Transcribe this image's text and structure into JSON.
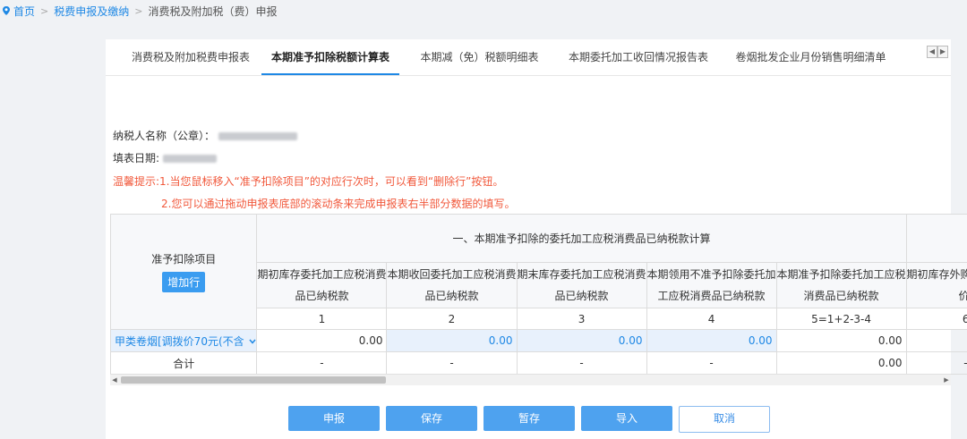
{
  "breadcrumb": {
    "home": "首页",
    "level2": "税费申报及缴纳",
    "current": "消费税及附加税（费）申报",
    "separator": ">"
  },
  "tabs": [
    {
      "label": "消费税及附加税费申报表",
      "active": false
    },
    {
      "label": "本期准予扣除税额计算表",
      "active": true
    },
    {
      "label": "本期减（免）税额明细表",
      "active": false
    },
    {
      "label": "本期委托加工收回情况报告表",
      "active": false
    },
    {
      "label": "卷烟批发企业月份销售明细清单",
      "active": false
    }
  ],
  "info": {
    "taxpayer_label": "纳税人名称（公章）：",
    "date_label": "填表日期:",
    "tip_label": "温馨提示:",
    "tip1": "1.当您鼠标移入“准予扣除项目”的对应行次时，可以看到“删除行”按钮。",
    "tip2": "2.您可以通过拖动申报表底部的滚动条来完成申报表右半部分数据的填写。"
  },
  "table": {
    "item_header": "准予扣除项目",
    "add_row": "增加行",
    "group_header": "一、本期准予扣除的委托加工应税消费品已纳税款计算",
    "columns": [
      {
        "line1": "期初库存委托加工应税消费",
        "line2": "品已纳税款",
        "no": "1"
      },
      {
        "line1": "本期收回委托加工应税消费",
        "line2": "品已纳税款",
        "no": "2"
      },
      {
        "line1": "期末库存委托加工应税消费",
        "line2": "品已纳税款",
        "no": "3"
      },
      {
        "line1": "本期领用不准予扣除委托加",
        "line2": "工应税消费品已纳税款",
        "no": "4"
      },
      {
        "line1": "本期准予扣除委托加工应税",
        "line2": "消费品已纳税款",
        "no": "5=1+2-3-4"
      },
      {
        "line1": "期初库存外购",
        "line2": "价",
        "no": "6"
      }
    ],
    "row1": {
      "item": "甲类卷烟[调拨价70元(不含",
      "values": [
        "0.00",
        "0.00",
        "0.00",
        "0.00",
        "0.00",
        ""
      ]
    },
    "total": {
      "item": "合计",
      "values": [
        "-",
        "-",
        "-",
        "-",
        "0.00",
        "-"
      ]
    }
  },
  "buttons": {
    "declare": "申报",
    "save": "保存",
    "temp_save": "暂存",
    "import": "导入",
    "cancel": "取消"
  },
  "colors": {
    "accent": "#1e88e5",
    "warning": "#f1583b",
    "button": "#4ea2ef"
  }
}
